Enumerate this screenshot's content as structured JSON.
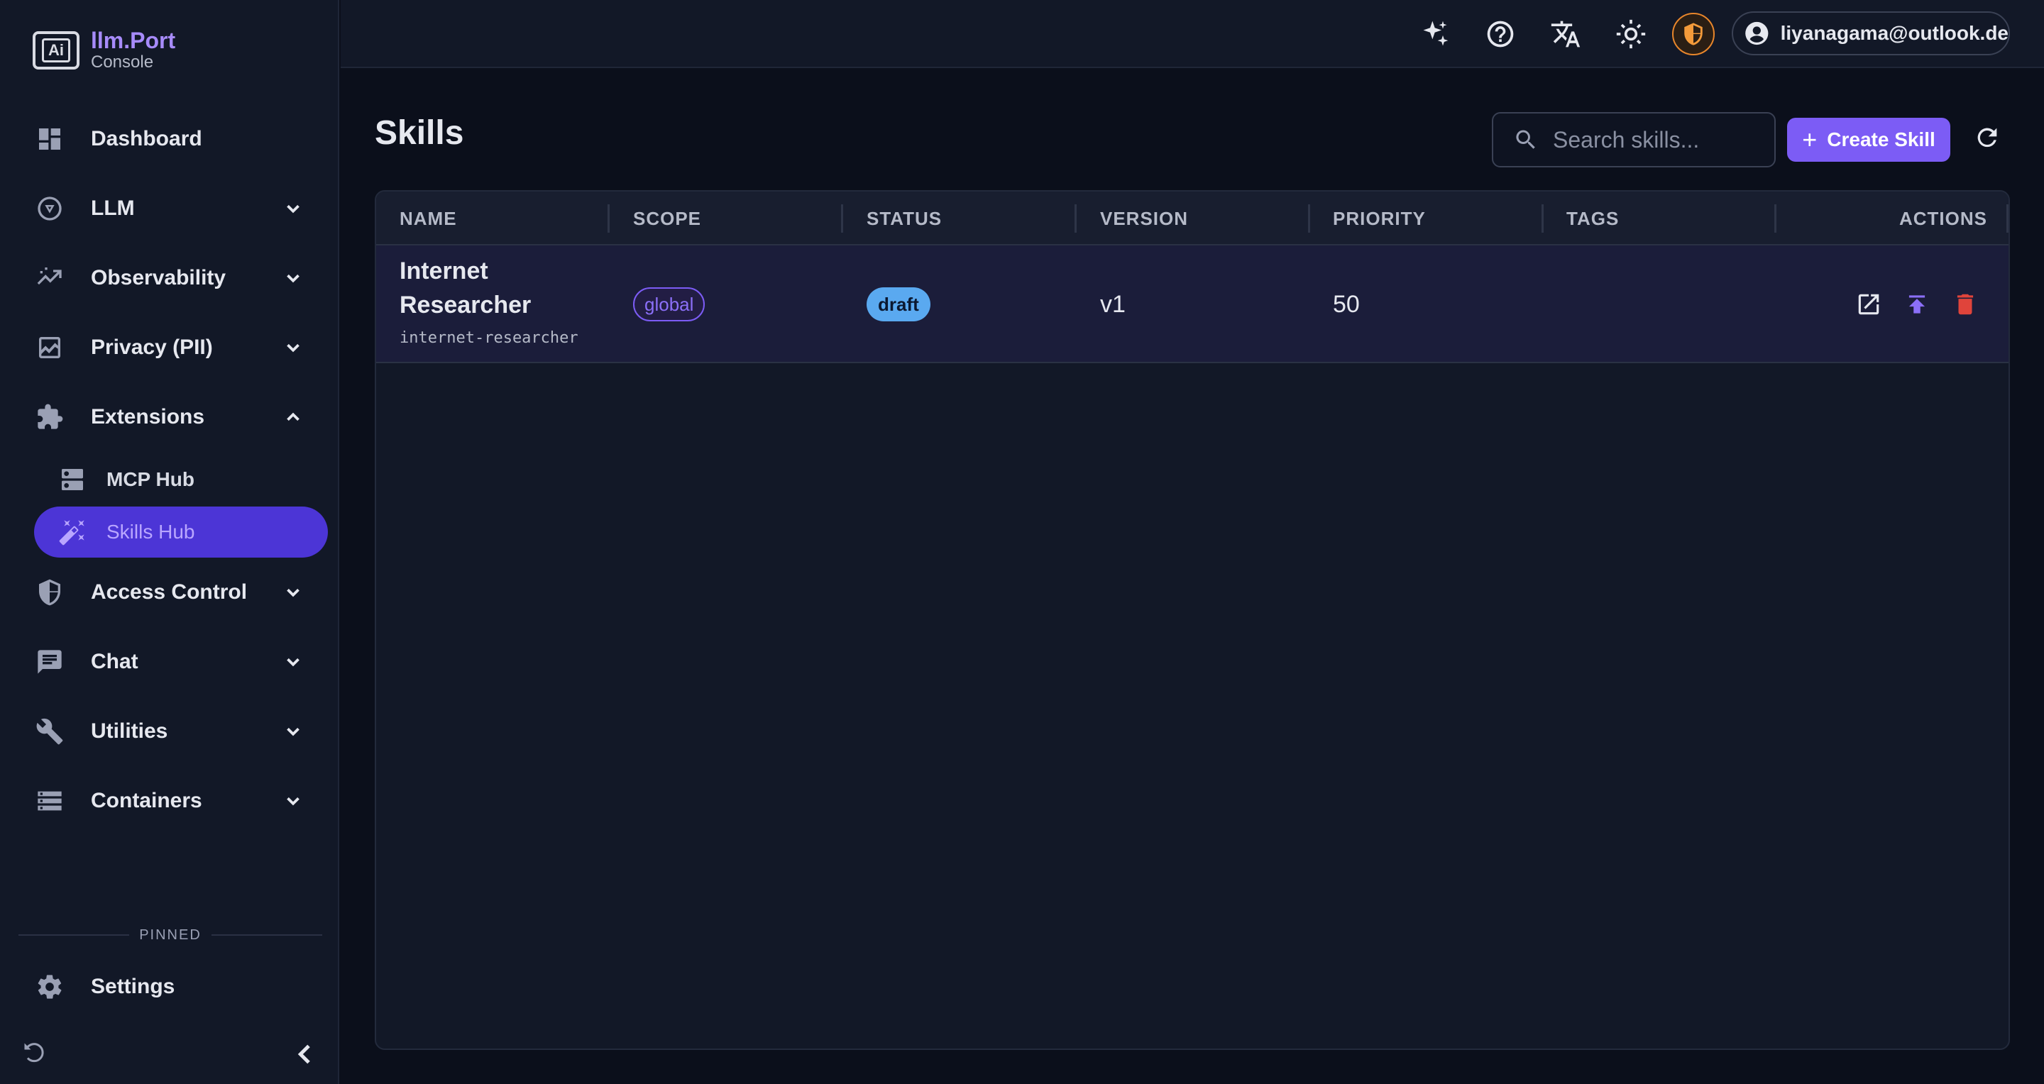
{
  "brand": {
    "name": "llm.Port",
    "subtitle": "Console",
    "logo_text": "Ai"
  },
  "sidebar": {
    "items": [
      {
        "label": "Dashboard"
      },
      {
        "label": "LLM"
      },
      {
        "label": "Observability"
      },
      {
        "label": "Privacy (PII)"
      },
      {
        "label": "Extensions"
      },
      {
        "label": "Access Control"
      },
      {
        "label": "Chat"
      },
      {
        "label": "Utilities"
      },
      {
        "label": "Containers"
      }
    ],
    "extensions_children": [
      {
        "label": "MCP Hub"
      },
      {
        "label": "Skills Hub",
        "active": true
      }
    ],
    "pinned_label": "PINNED",
    "pinned_items": [
      {
        "label": "Settings"
      }
    ]
  },
  "topbar": {
    "user_email": "liyanagama@outlook.de",
    "icons": [
      "sparkle-icon",
      "help-icon",
      "translate-icon",
      "theme-icon",
      "shield-icon"
    ]
  },
  "page": {
    "title": "Skills",
    "search_placeholder": "Search skills...",
    "create_label": "Create Skill",
    "create_plus": "+"
  },
  "table": {
    "columns": [
      "NAME",
      "SCOPE",
      "STATUS",
      "VERSION",
      "PRIORITY",
      "TAGS",
      "ACTIONS"
    ],
    "rows": [
      {
        "name_line1": "Internet",
        "name_line2": "Researcher",
        "slug": "internet-researcher",
        "scope": "global",
        "status": "draft",
        "version": "v1",
        "priority": "50",
        "tags": ""
      }
    ]
  },
  "colors": {
    "accent": "#7c5cf5",
    "active_nav": "#4c35d6",
    "draft_badge": "#5aa9f0",
    "delete": "#e0443b",
    "warning": "#f39a3a"
  }
}
